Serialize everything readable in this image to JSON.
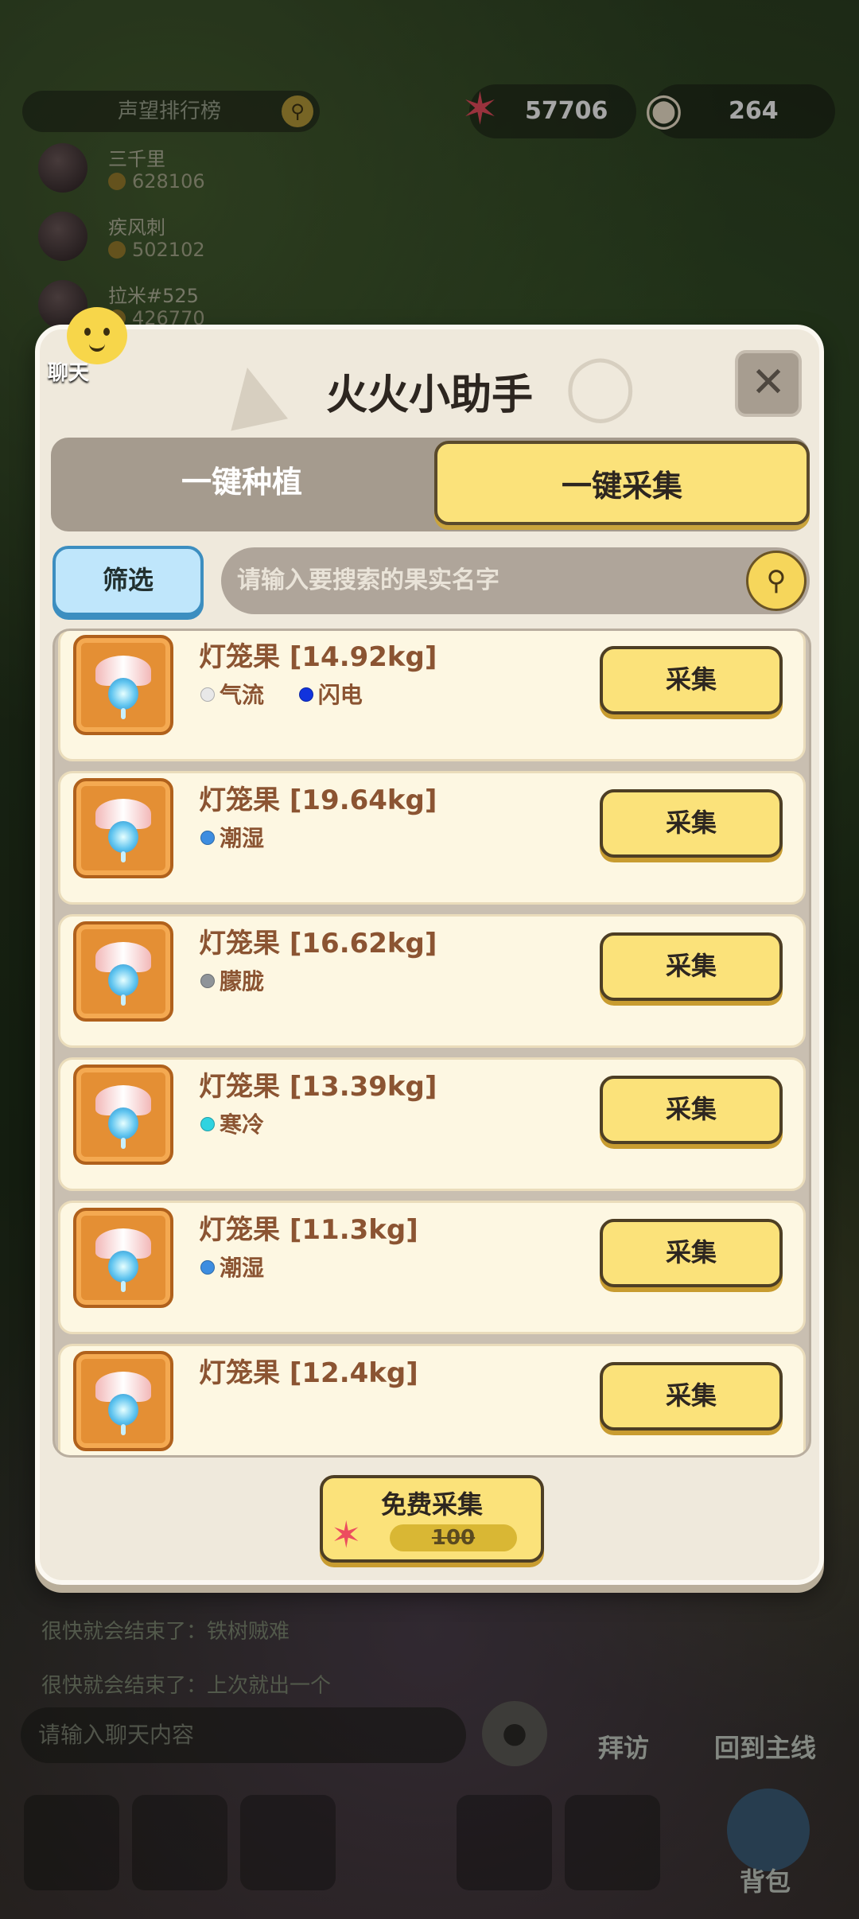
{
  "background": {
    "leaderboard": {
      "title": "声望排行榜",
      "entries": [
        {
          "name": "三千里",
          "score": "628106"
        },
        {
          "name": "疾风刺",
          "score": "502102"
        },
        {
          "name": "拉米#525",
          "score": "426770"
        }
      ]
    },
    "currencies": [
      {
        "icon": "starfish-icon",
        "value": "57706"
      },
      {
        "icon": "pearl-icon",
        "value": "264"
      }
    ],
    "chat_bubble_label": "聊天",
    "chat_messages": [
      "很快就会结束了：铁树贼难",
      "很快就会结束了：上次就出一个"
    ],
    "chat_input_placeholder": "请输入聊天内容",
    "visit_label": "拜访",
    "main_line_label": "回到主线",
    "bag_label": "背包"
  },
  "dialog": {
    "title": "火火小助手",
    "close_icon": "close-icon",
    "tabs": [
      {
        "label": "一键种植",
        "active": false
      },
      {
        "label": "一键采集",
        "active": true
      }
    ],
    "filter_label": "筛选",
    "search_placeholder": "请输入要搜索的果实名字",
    "items": [
      {
        "name": "灯笼果 [14.92kg]",
        "tags": [
          {
            "label": "气流",
            "color": "#e8e8e8"
          },
          {
            "label": "闪电",
            "color": "#1133dd"
          }
        ],
        "button": "采集"
      },
      {
        "name": "灯笼果 [19.64kg]",
        "tags": [
          {
            "label": "潮湿",
            "color": "#3d8de0"
          }
        ],
        "button": "采集"
      },
      {
        "name": "灯笼果 [16.62kg]",
        "tags": [
          {
            "label": "朦胧",
            "color": "#8f9499"
          }
        ],
        "button": "采集"
      },
      {
        "name": "灯笼果 [13.39kg]",
        "tags": [
          {
            "label": "寒冷",
            "color": "#2fd3e0"
          }
        ],
        "button": "采集"
      },
      {
        "name": "灯笼果 [11.3kg]",
        "tags": [
          {
            "label": "潮湿",
            "color": "#3d8de0"
          }
        ],
        "button": "采集"
      },
      {
        "name": "灯笼果 [12.4kg]",
        "tags": [],
        "button": "采集"
      }
    ],
    "free_collect": {
      "label": "免费采集",
      "cost": "100"
    }
  }
}
